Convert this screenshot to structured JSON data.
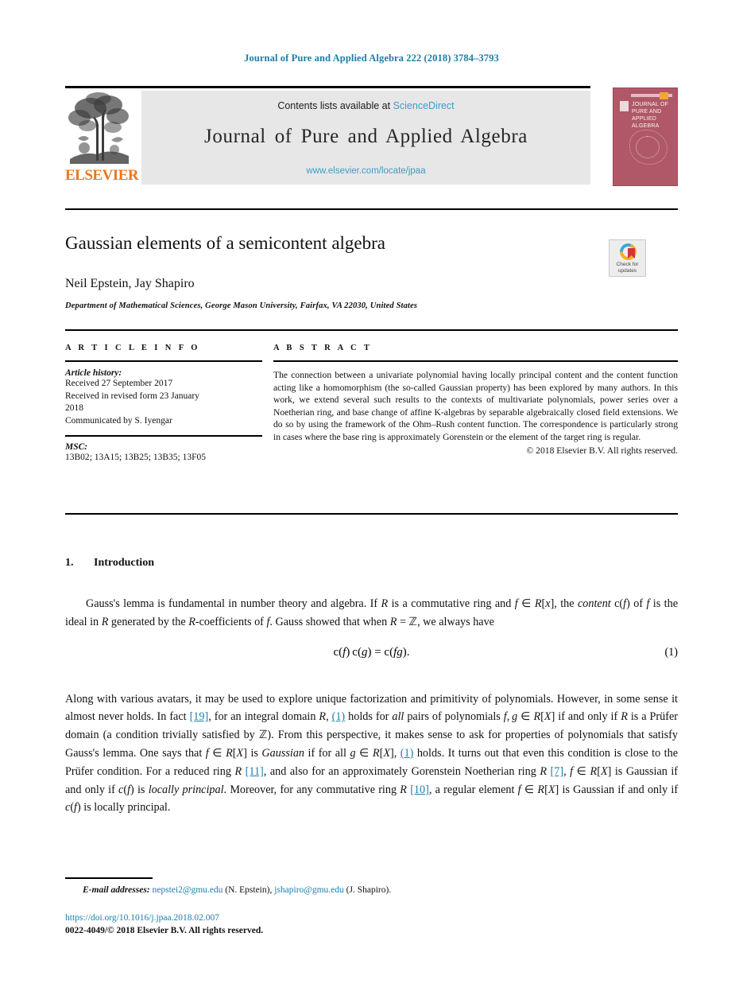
{
  "running_head": "Journal of Pure and Applied Algebra 222 (2018) 3784–3793",
  "masthead": {
    "contents_prefix": "Contents lists available at ",
    "contents_link": "ScienceDirect",
    "journal_name": "Journal of Pure and Applied Algebra",
    "journal_url": "www.elsevier.com/locate/jpaa",
    "publisher_wordmark": "ELSEVIER",
    "cover_title": "JOURNAL OF PURE AND APPLIED ALGEBRA",
    "link_color": "#3c9dc4",
    "cover_color": "#b05868"
  },
  "title_block": {
    "title": "Gaussian elements of a semicontent algebra",
    "authors": "Neil Epstein, Jay Shapiro",
    "affiliation": "Department of Mathematical Sciences, George Mason University, Fairfax, VA 22030, United States",
    "crossmark_label": "Check for updates"
  },
  "article_info": {
    "heading": "A R T I C L E   I N F O",
    "history_label": "Article history:",
    "history_lines": [
      "Received 27 September 2017",
      "Received in revised form 23 January",
      "2018",
      "Communicated by S. Iyengar"
    ],
    "msc_label": "MSC:",
    "msc_codes": "13B02; 13A15; 13B25; 13B35; 13F05"
  },
  "abstract": {
    "heading": "A B S T R A C T",
    "text": "The connection between a univariate polynomial having locally principal content and the content function acting like a homomorphism (the so-called Gaussian property) has been explored by many authors. In this work, we extend several such results to the contexts of multivariate polynomials, power series over a Noetherian ring, and base change of affine K-algebras by separable algebraically closed field extensions. We do so by using the framework of the Ohm–Rush content function. The correspondence is particularly strong in cases where the base ring is approximately Gorenstein or the element of the target ring is regular.",
    "copyright": "© 2018 Elsevier B.V. All rights reserved."
  },
  "body": {
    "section_number": "1.",
    "section_title": "Introduction",
    "para1_a": "Gauss's lemma is fundamental in number theory and algebra. If ",
    "para1_b": " is a commutative ring and ",
    "para1_c": ", the ",
    "para1_content_word": "content",
    "para1_d": " of ",
    "para1_e": " is the ideal in ",
    "para1_f": " generated by the ",
    "para1_g": "-coefficients of ",
    "para1_h": ". Gauss showed that when ",
    "para1_i": ", we always have",
    "equation": "c(f) c(g) = c(fg).",
    "equation_number": "(1)",
    "para2_a": "Along with various avatars, it may be used to explore unique factorization and primitivity of polynomials. However, in some sense it almost never holds. In fact ",
    "cite_19": "[19]",
    "para2_b": ", for an integral domain ",
    "cite_eq1": "(1)",
    "para2_c": " holds for ",
    "para2_all": "all",
    "para2_d": " pairs of polynomials ",
    "para2_e": " if and only if ",
    "para2_f": " is a Prüfer domain (a condition trivially satisfied by ",
    "para2_g": "). From this perspective, it makes sense to ask for properties of polynomials that satisfy Gauss's lemma. One says that ",
    "para2_h": " is ",
    "para2_gaussian": "Gaussian",
    "para2_i": " if for all ",
    "para2_j": " holds. It turns out that even this condition is close to the Prüfer condition. For a reduced ring ",
    "cite_11": "[11]",
    "para2_k": ", and also for an approximately Gorenstein Noetherian ring ",
    "cite_7": "[7]",
    "para2_l": " is Gaussian if and only if ",
    "para2_locally_principal": "locally principal",
    "para2_m": ". Moreover, for any commutative ring ",
    "cite_10": "[10]",
    "para2_n": ", a regular element ",
    "para2_o": " is Gaussian if and only if ",
    "para2_p": " is locally principal."
  },
  "footer": {
    "email_label": "E-mail addresses:",
    "email1": "nepstei2@gmu.edu",
    "email1_owner": "(N. Epstein),",
    "email2": "jshapiro@gmu.edu",
    "email2_owner": "(J. Shapiro).",
    "doi": "https://doi.org/10.1016/j.jpaa.2018.02.007",
    "issn_line": "0022-4049/© 2018 Elsevier B.V. All rights reserved."
  }
}
